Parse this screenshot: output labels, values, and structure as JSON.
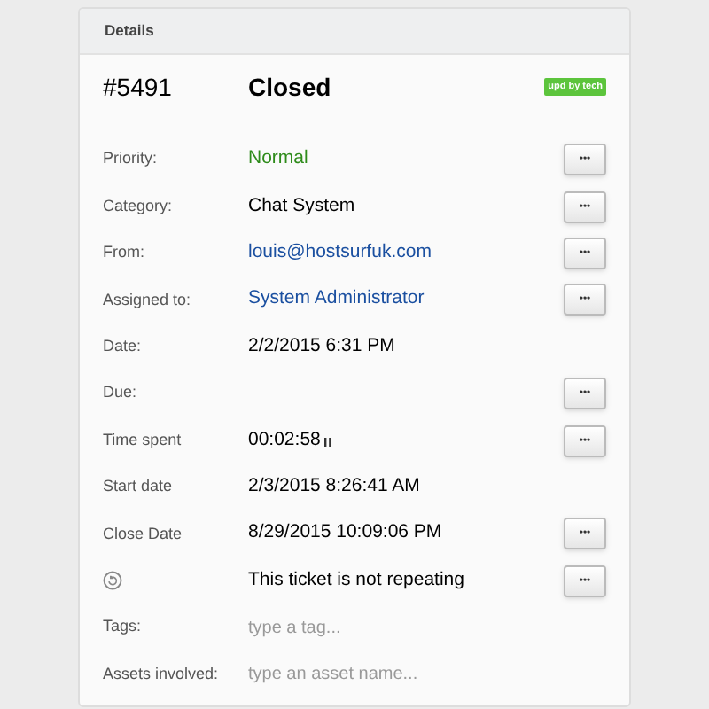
{
  "panel": {
    "title": "Details"
  },
  "ticket": {
    "number": "#5491",
    "status": "Closed",
    "badge": "upd by tech"
  },
  "rows": [
    {
      "kind": "text",
      "label": "Priority:",
      "value": "Normal",
      "color": "#2e8b1a",
      "has_button": true
    },
    {
      "kind": "text",
      "label": "Category:",
      "value": "Chat System",
      "color": "#000000",
      "has_button": true
    },
    {
      "kind": "text",
      "label": "From:",
      "value": "louis@hostsurfuk.com",
      "color": "#1a4fa0",
      "has_button": true
    },
    {
      "kind": "text",
      "label": "Assigned to:",
      "value": "System Administrator",
      "color": "#1a4fa0",
      "has_button": true
    },
    {
      "kind": "text",
      "label": "Date:",
      "value": "2/2/2015 6:31 PM",
      "color": "#000000",
      "has_button": false
    },
    {
      "kind": "text",
      "label": "Due:",
      "has_button": true
    },
    {
      "kind": "timer",
      "label": "Time spent",
      "value": "00:02:58",
      "color": "#000000",
      "has_button": true
    },
    {
      "kind": "text",
      "label": "Start date",
      "value": "2/3/2015 8:26:41 AM",
      "color": "#000000",
      "has_button": false
    },
    {
      "kind": "text",
      "label": "Close Date",
      "value": "8/29/2015 10:09:06 PM",
      "color": "#000000",
      "has_button": true
    },
    {
      "kind": "repeat",
      "value": "This ticket is not repeating",
      "color": "#000000",
      "has_button": true
    },
    {
      "kind": "field",
      "label": "Tags:",
      "placeholder": "type a tag...",
      "has_button": false
    },
    {
      "kind": "field",
      "label": "Assets involved:",
      "placeholder": "type an asset name...",
      "has_button": false
    }
  ],
  "button_label": "•••"
}
